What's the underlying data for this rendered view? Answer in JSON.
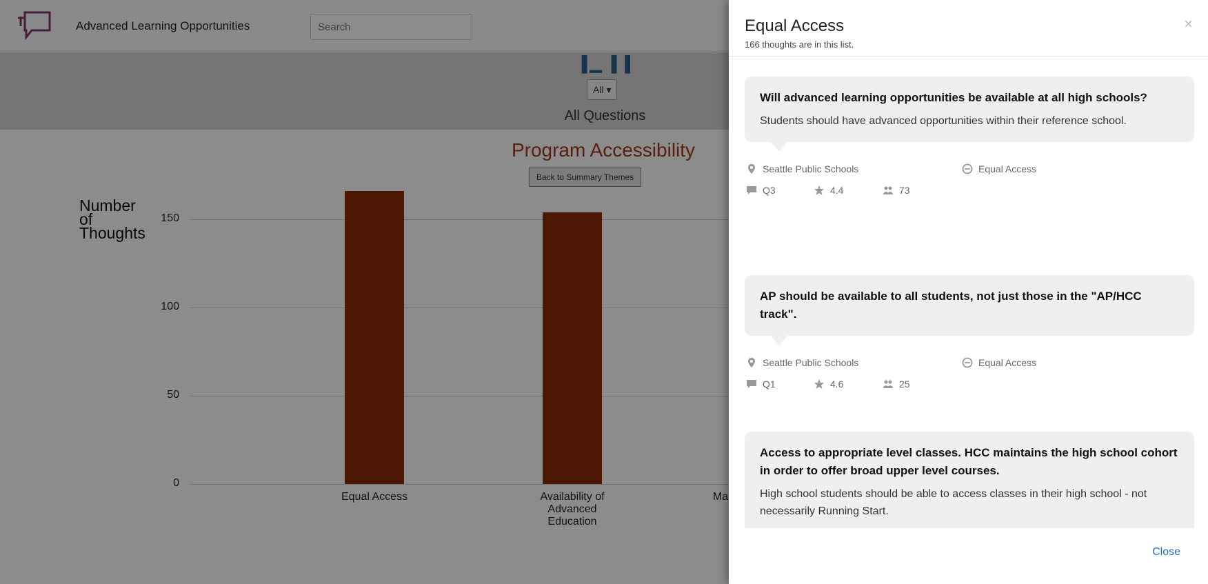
{
  "app": {
    "title": "Advanced Learning Opportunities",
    "search_placeholder": "Search",
    "filter_value": "All",
    "section_title": "All Questions",
    "chart_title": "Program Accessibility",
    "back_button": "Back to Summary Themes",
    "y_axis_label_1": "Number",
    "y_axis_label_2": "of",
    "y_axis_label_3": "Thoughts",
    "truncated_category": "Ma"
  },
  "chart_data": {
    "type": "bar",
    "title": "Program Accessibility",
    "ylabel": "Number of Thoughts",
    "xlabel": "",
    "ylim": [
      0,
      166
    ],
    "yticks": [
      0,
      50,
      100,
      150
    ],
    "categories": [
      "Equal Access",
      "Availability of Advanced Education"
    ],
    "category_lines": [
      [
        "Equal Access"
      ],
      [
        "Availability of",
        "Advanced",
        "Education"
      ]
    ],
    "values": [
      166,
      154
    ],
    "bar_color": "#8a2b06"
  },
  "modal": {
    "title": "Equal Access",
    "subtitle": "166 thoughts are in this list.",
    "close_button": "Close",
    "close_x": "×",
    "cards": [
      {
        "title": "Will advanced learning opportunities be available at all high schools?",
        "text": "Students should have advanced opportunities within their reference school.",
        "location": "Seattle Public Schools",
        "theme": "Equal Access",
        "question": "Q3",
        "rating": "4.4",
        "participants": "73"
      },
      {
        "title": "AP should be available to all students, not just those in the \"AP/HCC track\".",
        "text": "",
        "location": "Seattle Public Schools",
        "theme": "Equal Access",
        "question": "Q1",
        "rating": "4.6",
        "participants": "25"
      },
      {
        "title": "Access to appropriate level classes. HCC maintains the high school cohort in order to offer broad upper level courses.",
        "text": "High school students should be able to access classes in their high school - not necessarily Running Start.",
        "location": "",
        "theme": "",
        "question": "",
        "rating": "",
        "participants": ""
      }
    ]
  }
}
